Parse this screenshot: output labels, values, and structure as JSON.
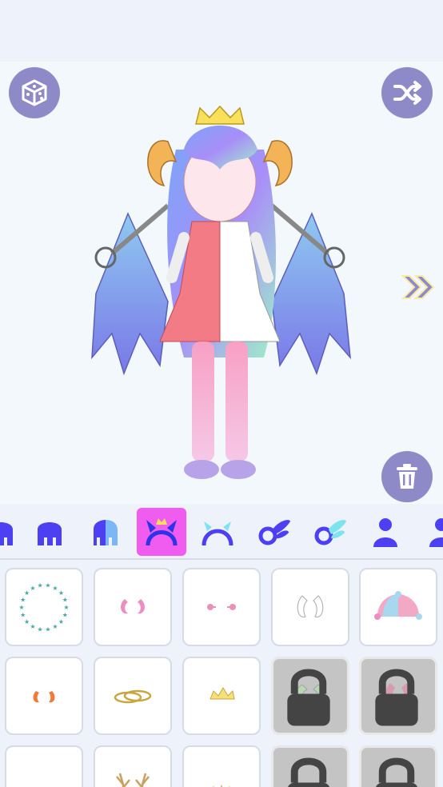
{
  "toolbar": {
    "dice_button": "dice-icon",
    "shuffle_button": "shuffle-icon",
    "next_button": "double-chevron-right-icon",
    "trash_button": "trash-icon"
  },
  "colors": {
    "accent": "#8e8ac8",
    "category_icon": "#4d3ff2",
    "category_active_bg": "#f05cf0",
    "stage_bg": "#f3f8fd",
    "panel_bg": "#eef2fb"
  },
  "categories": [
    {
      "icon": "hair-front-icon",
      "selected": false
    },
    {
      "icon": "hair-back-icon",
      "selected": false
    },
    {
      "icon": "hair-color-icon",
      "selected": false
    },
    {
      "icon": "horns-headband-icon",
      "selected": true
    },
    {
      "icon": "headband-icon",
      "selected": false
    },
    {
      "icon": "wings-icon",
      "selected": false
    },
    {
      "icon": "wings-alt-icon",
      "selected": false
    },
    {
      "icon": "body-icon",
      "selected": false
    },
    {
      "icon": "body-alt-icon",
      "selected": false
    }
  ],
  "items": [
    {
      "icon": "star-halo-icon",
      "locked": false
    },
    {
      "icon": "small-pink-horns-icon",
      "locked": false
    },
    {
      "icon": "earrings-icon",
      "locked": false
    },
    {
      "icon": "white-horns-icon",
      "locked": false
    },
    {
      "icon": "jester-hat-icon",
      "locked": false
    },
    {
      "icon": "orange-horns-icon",
      "locked": false
    },
    {
      "icon": "gold-rings-halo-icon",
      "locked": false
    },
    {
      "icon": "tiara-icon",
      "locked": false
    },
    {
      "icon": "curled-horns-icon",
      "locked": true
    },
    {
      "icon": "demon-horns-icon",
      "locked": true
    },
    {
      "icon": "empty-slot",
      "locked": false
    },
    {
      "icon": "antlers-icon",
      "locked": false
    },
    {
      "icon": "sun-crown-icon",
      "locked": false
    },
    {
      "icon": "fin-ears-icon",
      "locked": true
    },
    {
      "icon": "purple-halo-icon",
      "locked": true
    }
  ]
}
